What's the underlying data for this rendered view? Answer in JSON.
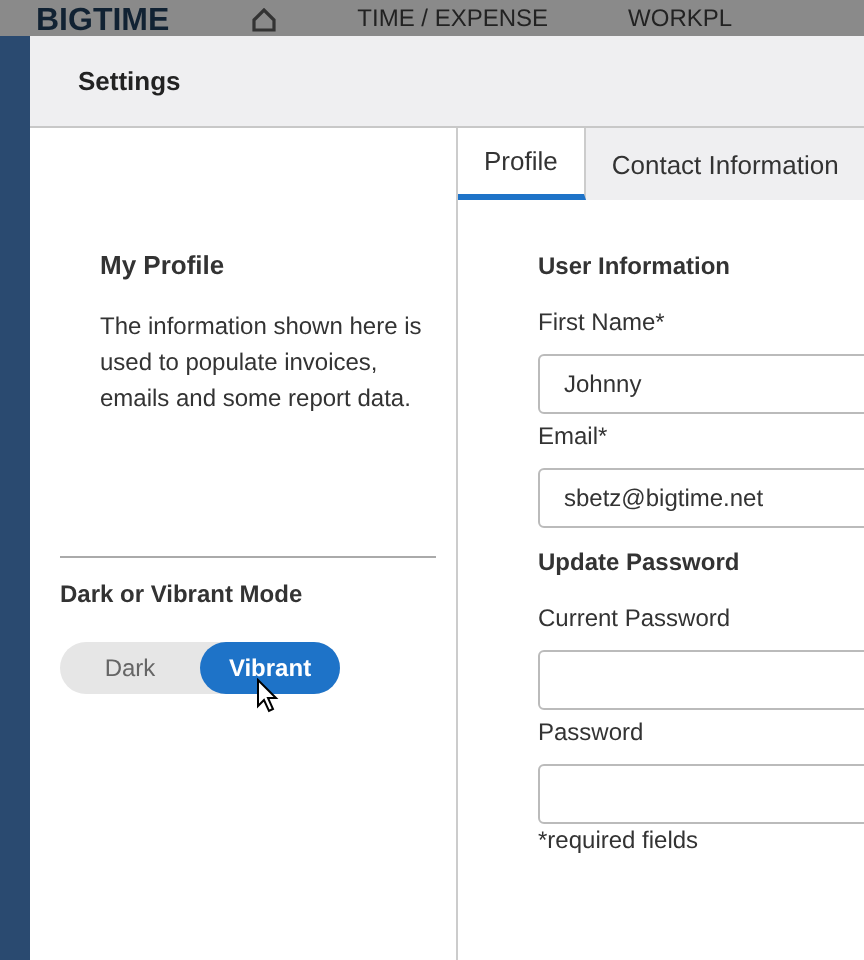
{
  "app_bar": {
    "logo": "BIGTIME",
    "nav": [
      "TIME / EXPENSE",
      "WORKPL"
    ]
  },
  "dialog": {
    "title": "Settings",
    "sidebar": {
      "heading": "My Profile",
      "description": "The information shown here is used to populate invoices, emails and some report data.",
      "mode_label": "Dark or Vibrant Mode",
      "mode_options": [
        {
          "label": "Dark",
          "selected": false
        },
        {
          "label": "Vibrant",
          "selected": true
        }
      ]
    },
    "tabs": [
      {
        "label": "Profile",
        "selected": true
      },
      {
        "label": "Contact Information",
        "selected": false
      }
    ],
    "sections": [
      {
        "heading": "User Information",
        "fields": [
          {
            "label": "First Name*",
            "value": "Johnny"
          },
          {
            "label": "Email*",
            "value": "sbetz@bigtime.net"
          }
        ]
      },
      {
        "heading": "Update Password",
        "fields": [
          {
            "label": "Current Password"
          },
          {
            "label": "Password"
          }
        ]
      }
    ],
    "footnote": "*required fields"
  }
}
